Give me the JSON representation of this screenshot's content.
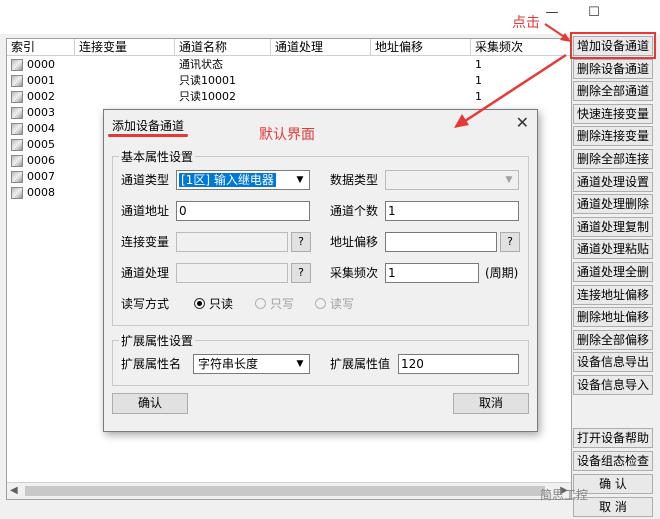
{
  "window": {
    "minimize": "—",
    "maximize": "☐"
  },
  "annotations": {
    "click_label": "点击",
    "default_label": "默认界面",
    "color": "#e53935"
  },
  "list": {
    "columns": [
      "索引",
      "连接变量",
      "通道名称",
      "通道处理",
      "地址偏移",
      "采集频次"
    ],
    "rows": [
      {
        "index": "0000",
        "name": "通讯状态",
        "freq": "1"
      },
      {
        "index": "0001",
        "name": "只读10001",
        "freq": "1"
      },
      {
        "index": "0002",
        "name": "只读10002",
        "freq": "1"
      },
      {
        "index": "0003",
        "name": "",
        "freq": ""
      },
      {
        "index": "0004",
        "name": "",
        "freq": ""
      },
      {
        "index": "0005",
        "name": "",
        "freq": ""
      },
      {
        "index": "0006",
        "name": "",
        "freq": ""
      },
      {
        "index": "0007",
        "name": "",
        "freq": ""
      },
      {
        "index": "0008",
        "name": "",
        "freq": ""
      }
    ]
  },
  "side_buttons": [
    "增加设备通道",
    "删除设备通道",
    "删除全部通道",
    "快速连接变量",
    "删除连接变量",
    "删除全部连接",
    "通道处理设置",
    "通道处理删除",
    "通道处理复制",
    "通道处理粘贴",
    "通道处理全删",
    "连接地址偏移",
    "删除地址偏移",
    "删除全部偏移",
    "设备信息导出",
    "设备信息导入"
  ],
  "bottom_buttons": [
    "打开设备帮助",
    "设备组态检查",
    "确    认",
    "取    消"
  ],
  "dialog": {
    "title": "添加设备通道",
    "close": "✕",
    "basic_group": "基本属性设置",
    "channel_type_label": "通道类型",
    "channel_type_value": "[1区] 输入继电器",
    "data_type_label": "数据类型",
    "channel_addr_label": "通道地址",
    "channel_addr_value": "0",
    "channel_count_label": "通道个数",
    "channel_count_value": "1",
    "conn_var_label": "连接变量",
    "addr_offset_label": "地址偏移",
    "channel_proc_label": "通道处理",
    "freq_label": "采集频次",
    "freq_value": "1",
    "freq_unit": "(周期)",
    "qmark": "?",
    "rw_label": "读写方式",
    "rw_options": [
      "只读",
      "只写",
      "读写"
    ],
    "ext_group": "扩展属性设置",
    "ext_name_label": "扩展属性名",
    "ext_name_value": "字符串长度",
    "ext_value_label": "扩展属性值",
    "ext_value_value": "120",
    "ok": "确认",
    "cancel": "取消"
  },
  "watermark": "简思工控"
}
